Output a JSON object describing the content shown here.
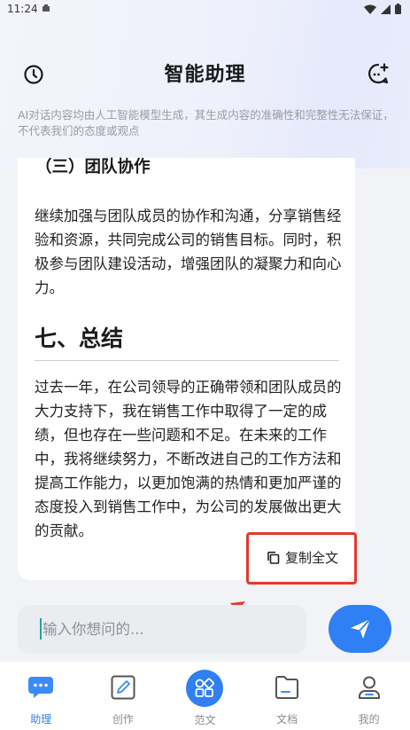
{
  "status_bar": {
    "time": "11:24"
  },
  "header": {
    "title": "智能助理",
    "history_icon": "clock-icon",
    "new_chat_icon": "chat-plus-icon"
  },
  "disclaimer": "AI对话内容均由人工智能模型生成，其生成内容的准确性和完整性无法保证，不代表我们的态度或观点",
  "answer": {
    "sub_heading": "（三）团队协作",
    "paragraph_1": "继续加强与团队成员的协作和沟通，分享销售经验和资源，共同完成公司的销售目标。同时，积极参与团队建设活动，增强团队的凝聚力和向心力。",
    "section_heading": "七、总结",
    "paragraph_2": "过去一年，在公司领导的正确带领和团队成员的大力支持下，我在销售工作中取得了一定的成绩，但也存在一些问题和不足。在未来的工作中，我将继续努力，不断改进自己的工作方法和提高工作能力，以更加饱满的热情和更加严谨的态度投入到销售工作中，为公司的发展做出更大的贡献。",
    "copy_label": "复制全文"
  },
  "input": {
    "placeholder": "输入你想问的...",
    "value": ""
  },
  "nav": {
    "items": [
      {
        "label": "助理",
        "icon": "chat-bubble-icon",
        "active": true
      },
      {
        "label": "创作",
        "icon": "pencil-edit-icon",
        "active": false
      },
      {
        "label": "范文",
        "icon": "grid-apps-icon",
        "active": false
      },
      {
        "label": "文档",
        "icon": "document-folder-icon",
        "active": false
      },
      {
        "label": "我的",
        "icon": "user-icon",
        "active": false
      }
    ]
  },
  "colors": {
    "accent": "#2f7ff5",
    "annotation": "#e23a2c"
  }
}
